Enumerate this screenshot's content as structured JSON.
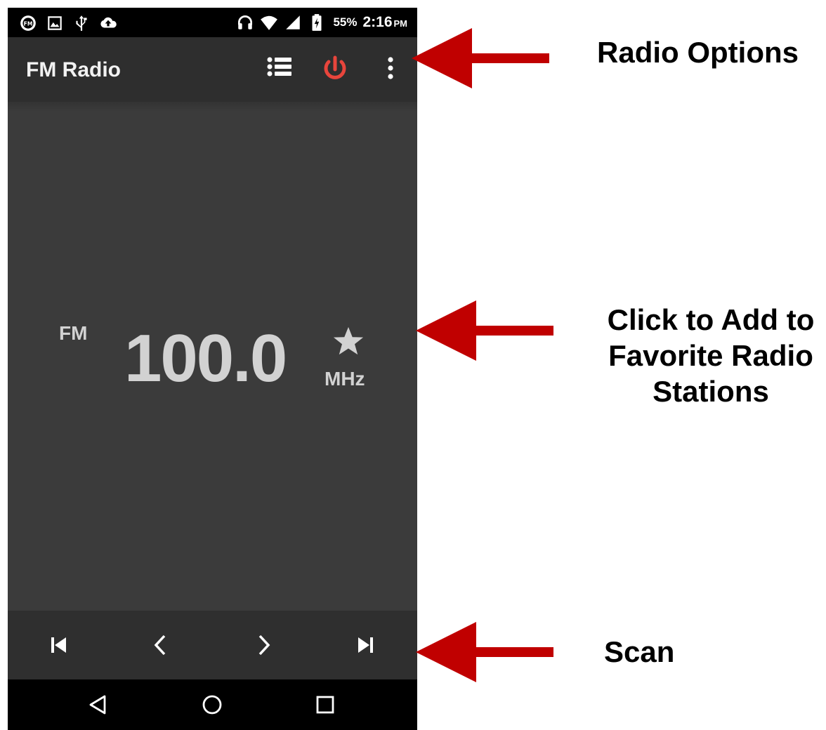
{
  "status_bar": {
    "battery_percent": "55%",
    "time": "2:16",
    "ampm": "PM",
    "left_icons": [
      "fm-radio-icon",
      "image-icon",
      "usb-icon",
      "cloud-upload-icon"
    ],
    "right_icons": [
      "headset-icon",
      "wifi-icon",
      "signal-icon",
      "battery-charging-icon"
    ]
  },
  "app_bar": {
    "title": "FM Radio",
    "actions": [
      "station-list-icon",
      "power-icon",
      "more-options-icon"
    ],
    "power_color": "#e8453c"
  },
  "tuner": {
    "band": "FM",
    "frequency": "100.0",
    "unit": "MHz",
    "favorite_icon": "star-icon"
  },
  "controls": [
    "previous-station-icon",
    "seek-back-icon",
    "seek-forward-icon",
    "next-station-icon"
  ],
  "nav_bar": [
    "back-icon",
    "home-icon",
    "recents-icon"
  ],
  "annotations": {
    "radio_options": "Radio Options",
    "favorite_lines": [
      "Click to Add to",
      "Favorite Radio",
      "Stations"
    ],
    "scan": "Scan",
    "arrow_color": "#c00000"
  }
}
